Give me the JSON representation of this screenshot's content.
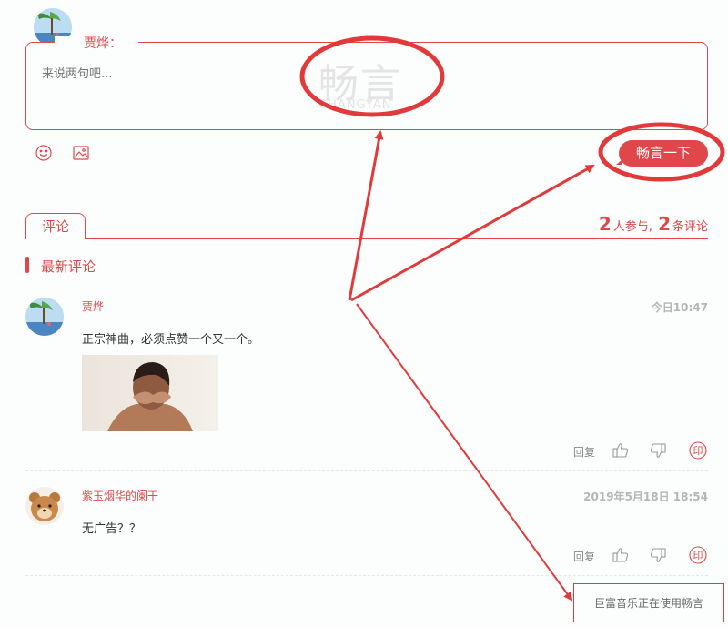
{
  "composer": {
    "username": "贾烨：",
    "placeholder": "来说两句吧...",
    "watermark_main": "畅言",
    "watermark_sub": "CHANGYAN",
    "emoji_icon": "smiley-icon",
    "image_icon": "image-icon",
    "submit_label": "畅言一下"
  },
  "tabs": {
    "active": "评论"
  },
  "stats": {
    "participants": "2",
    "participants_suffix": "人参与,",
    "comments": "2",
    "comments_suffix": "条评论"
  },
  "section": {
    "latest_label": "最新评论"
  },
  "comments": [
    {
      "user": "贾烨",
      "time": "今日10:47",
      "text": "正宗神曲，必须点赞一个又一个。",
      "has_photo": true,
      "reply_label": "回复"
    },
    {
      "user": "紫玉烟华的阑干",
      "time": "2019年5月18日 18:54",
      "text": "无广告？？",
      "has_photo": false,
      "reply_label": "回复"
    }
  ],
  "action_icons": [
    "thumbs-up-icon",
    "thumbs-down-icon",
    "stamp-icon"
  ],
  "stamp_glyph": "印",
  "footer": {
    "powered_by": "巨富音乐正在使用畅言"
  },
  "colors": {
    "accent": "#e0474b",
    "annotation": "#e23a3a",
    "muted": "#b6b6b6"
  }
}
